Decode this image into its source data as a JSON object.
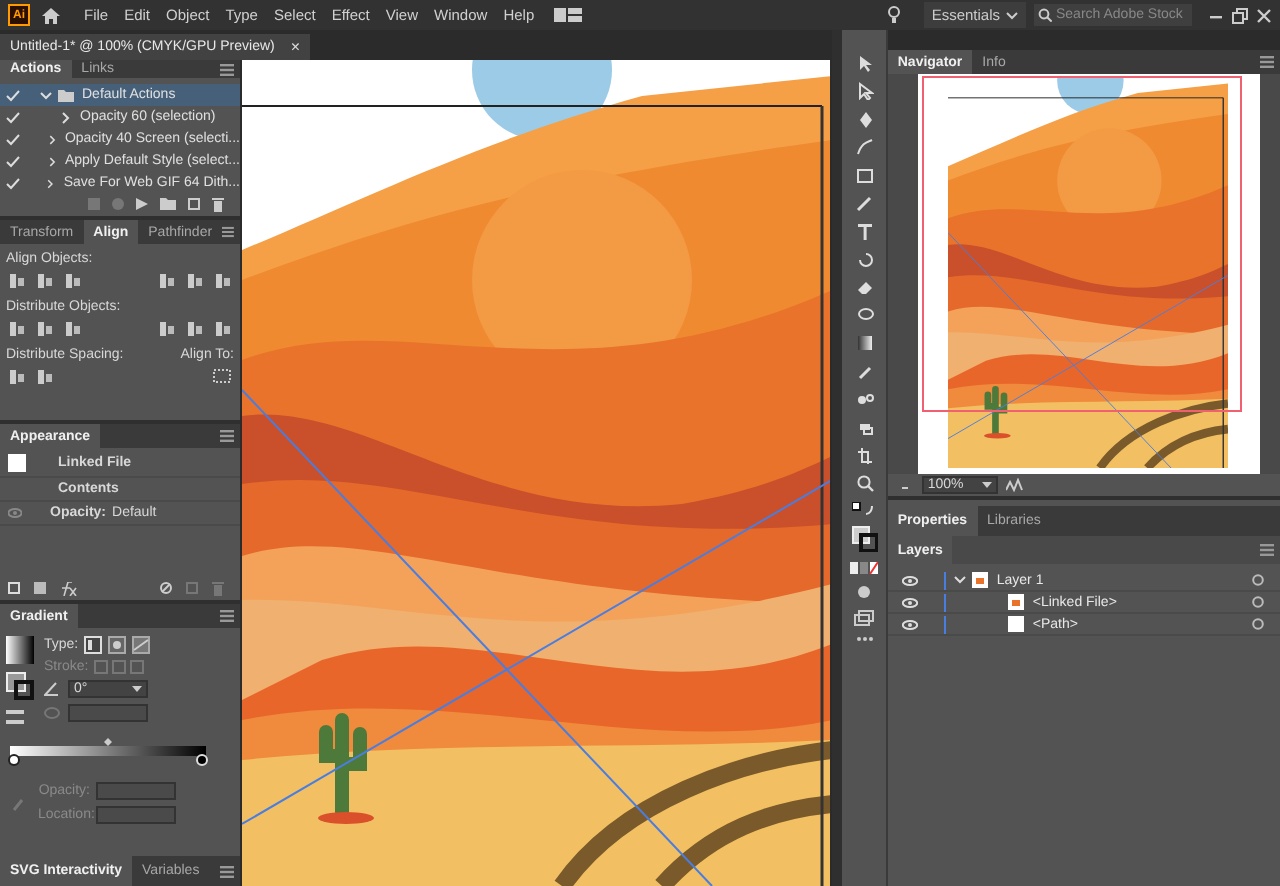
{
  "menubar": {
    "logo": "Ai",
    "menus": [
      "File",
      "Edit",
      "Object",
      "Type",
      "Select",
      "Effect",
      "View",
      "Window",
      "Help"
    ],
    "workspace": "Essentials",
    "search": {
      "placeholder": "Search Adobe Stock"
    }
  },
  "document_tab": {
    "title": "Untitled-1* @ 100% (CMYK/GPU Preview)",
    "close": "×"
  },
  "actions_panel": {
    "tabs": [
      {
        "label": "Actions",
        "selected": true
      },
      {
        "label": "Links",
        "selected": false
      }
    ],
    "tree": [
      {
        "label": "Default Actions",
        "checked": true,
        "expanded": true,
        "selected": true,
        "children": [
          {
            "label": "Opacity 60 (selection)",
            "checked": true,
            "expanded": false,
            "selected": false
          },
          {
            "label": "Opacity 40 Screen (selecti...",
            "checked": true,
            "expanded": false,
            "selected": false
          },
          {
            "label": "Apply Default Style (select...",
            "checked": true,
            "expanded": false,
            "selected": false
          },
          {
            "label": "Save For Web GIF 64 Dith...",
            "checked": true,
            "expanded": false,
            "selected": false
          }
        ]
      }
    ]
  },
  "align_panel": {
    "tabs": [
      {
        "label": "Transform",
        "selected": false
      },
      {
        "label": "Align",
        "selected": true
      },
      {
        "label": "Pathfinder",
        "selected": false
      }
    ],
    "sections": [
      "Align Objects:",
      "Distribute Objects:",
      "Distribute Spacing:"
    ],
    "align_to": "Align To:"
  },
  "appearance_panel": {
    "tab": "Appearance",
    "rows": [
      {
        "kind": "object",
        "label": "Linked File"
      },
      {
        "kind": "contents",
        "label": "Contents"
      },
      {
        "kind": "opacity",
        "label": "Opacity:",
        "value": "Default"
      }
    ]
  },
  "gradient_panel": {
    "tab": "Gradient",
    "type_label": "Type:",
    "stroke_label": "Stroke:",
    "angle": "0°",
    "opacity_label": "Opacity:",
    "location_label": "Location:"
  },
  "bottom_tabs": [
    {
      "label": "SVG Interactivity",
      "selected": true
    },
    {
      "label": "Variables",
      "selected": false
    }
  ],
  "navigator_panel": {
    "tabs": [
      {
        "label": "Navigator",
        "selected": true
      },
      {
        "label": "Info",
        "selected": false
      }
    ],
    "zoom": "100%"
  },
  "properties_tabs": [
    {
      "label": "Properties",
      "selected": true
    },
    {
      "label": "Libraries",
      "selected": false
    }
  ],
  "layers_panel": {
    "tab": "Layers",
    "tree": [
      {
        "label": "Layer 1",
        "visible": true,
        "expanded": true,
        "children": [
          {
            "label": "<Linked File>",
            "visible": true
          },
          {
            "label": "<Path>",
            "visible": true
          }
        ]
      }
    ]
  }
}
